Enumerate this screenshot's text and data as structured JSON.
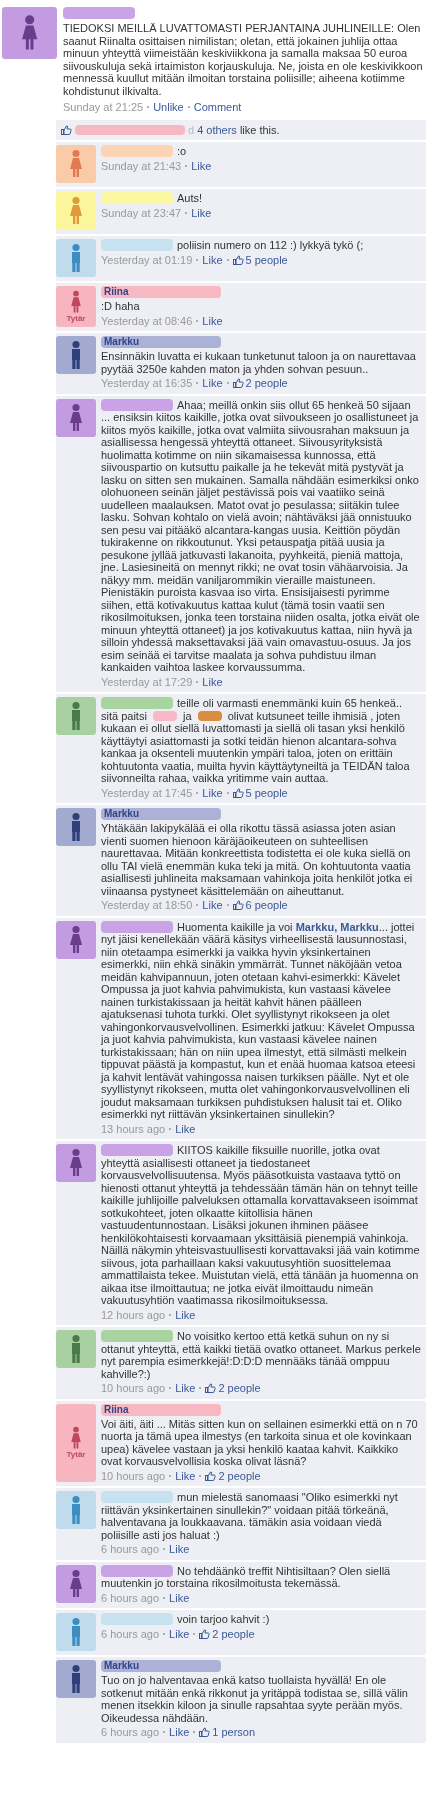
{
  "post": {
    "avatar": {
      "kind": "female",
      "color": "#c39be0",
      "figure": {
        "color": "#6a3d8c"
      }
    },
    "author": {
      "color": "#c9a3e6"
    },
    "text": "TIEDOKSI MEILLÄ LUVATTOMASTI PERJANTAINA JUHLINEILLE: Olen saanut Riinalta osittaisen nimilistan; oletan, että jokainen juhlija ottaa minuun yhteyttä viimeistään keskiviikkona ja samalla maksaa 50 euroa siivouskuluja sekä irtaimiston korjauskuluja. Ne, joista en ole keskivikkoon mennessä kuullut mitään ilmoitan torstaina poliisille; aiheena kotiimme kohdistunut ilkivalta.",
    "time": "Sunday at 21:25",
    "actions": [
      "Unlike",
      "Comment"
    ]
  },
  "likes": {
    "redaction": {
      "color": "#f7b8c4"
    },
    "prefix": "d",
    "link": "4 others",
    "suffix": "like this."
  },
  "comments": [
    {
      "avatar": {
        "kind": "female",
        "color": "#f9cba8",
        "figure": {
          "color": "#e07b50"
        }
      },
      "author": {
        "color": "#fcd3b4"
      },
      "text": ":o",
      "time": "Sunday at 21:43",
      "actions": [
        "Like"
      ]
    },
    {
      "avatar": {
        "kind": "female",
        "color": "#fbf59c",
        "figure": {
          "color": "#e09a3a"
        }
      },
      "author": {
        "color": "#fbf8a2"
      },
      "text": "Auts!",
      "time": "Sunday at 23:47",
      "actions": [
        "Like"
      ]
    },
    {
      "avatar": {
        "kind": "male",
        "color": "#c0dcec",
        "figure": {
          "color": "#3d8dc0"
        }
      },
      "author": {
        "color": "#c8e1ef"
      },
      "text": "poliisin numero on 112 :) lykkyä tykö (;",
      "time": "Yesterday at 01:19",
      "actions": [
        "Like"
      ],
      "people": "5 people"
    },
    {
      "avatar": {
        "kind": "female",
        "color": "#f7b5c0",
        "figure": {
          "color": "#c2475d"
        },
        "tag": "Tytär"
      },
      "author": {
        "color": "#f7b8c2",
        "name": "Riina"
      },
      "text": ":D haha",
      "time": "Yesterday at 08:46",
      "actions": [
        "Like"
      ]
    },
    {
      "avatar": {
        "kind": "male",
        "color": "#a3aacf",
        "figure": {
          "color": "#2e3f7a"
        }
      },
      "author": {
        "color": "#abb2d6",
        "name": "Markku"
      },
      "text": "Ensinnäkin luvatta ei kukaan tunketunut taloon ja on naurettavaa pyytää 3250e kahden maton ja yhden sohvan pesuun..",
      "time": "Yesterday at 16:35",
      "actions": [
        "Like"
      ],
      "people": "2 people"
    },
    {
      "avatar": {
        "kind": "female",
        "color": "#c39be0",
        "figure": {
          "color": "#6a3d8c"
        }
      },
      "author": {
        "color": "#c9a3e6"
      },
      "text": "Ahaa; meillä onkin siis ollut 65 henkeä 50 sijaan ... ensiksin kiitos kaikille, jotka ovat siivoukseen jo osallistuneet ja kiitos myös kaikille, jotka ovat valmiita siivousrahan maksuun ja asiallisessa hengessä yhteyttä ottaneet. Siivousyrityksistä huolimatta kotimme on niin sikamaisessa kunnossa, että siivouspartio on kutsuttu paikalle ja he tekevät mitä pystyvät ja lasku on sitten sen mukainen. Samalla nähdään esimerkiksi onko olohuoneen seinän jäljet pestävissä pois vai vaatiiko seinä uudelleen maalauksen. Matot ovat jo pesulassa; siitäkin tulee lasku. Sohvan kohtalo on vielä avoin; nähtäväksi jää onnistuuko sen pesu vai pitääkö alcantara-kangas uusia. Keittiön pöydän tukirakenne on rikkoutunut. Yksi petauspatja pitää uusia ja pesukone jyllää jatkuvasti lakanoita, pyyhkeitä, pieniä mattoja, jne. Lasiesineitä on mennyt rikki; ne ovat tosin vähäarvoisia. Ja näkyy mm. meidän vaniljarommikin vieraille maistuneen. Pienistäkin puroista kasvaa iso virta. Ensisijaisesti pyrimme siihen, että kotivakuutus kattaa kulut (tämä tosin vaatii sen rikosilmoituksen, jonka teen torstaina niiden osalta, jotka eivät ole minuun yhteyttä ottaneet) ja jos kotivakuutus kattaa, niin hyvä ja silloin yhdessä maksettavaksi jää vain omavastuu-osuus. Ja jos esim seinää ei tarvitse maalata ja sohva puhdistuu ilman kankaiden vaihtoa laskee korvaussumma.",
      "time": "Yesterday at 17:29",
      "actions": [
        "Like"
      ]
    },
    {
      "avatar": {
        "kind": "male",
        "color": "#a8d0a0",
        "figure": {
          "color": "#4a7a48"
        }
      },
      "author": {
        "color": "#a8d4a0"
      },
      "parts": [
        {
          "kind": "text",
          "text": "teille oli varmasti enemmänki kuin 65 henkeä.. sitä paitsi"
        },
        {
          "kind": "redaction",
          "color": "#f9b8c6"
        },
        {
          "kind": "text",
          "text": "ja"
        },
        {
          "kind": "redaction",
          "color": "#d98d3e"
        },
        {
          "kind": "text",
          "text": "olivat kutsuneet teille ihmisiä , joten kukaan ei ollut siellä luvattomasti ja siellä oli tasan yksi henkilö käyttäytyi asiattomasti ja sotki teidän hienon alcantara-sohva kankaa ja oksenteli muutenkin ympäri taloa, joten on erittäin kohtuutonta vaatia, muilta hyvin käyttäytyneiltä ja TEIDÄN taloa siivonneilta rahaa, vaikka yritimme vain auttaa."
        }
      ],
      "time": "Yesterday at 17:45",
      "actions": [
        "Like"
      ],
      "people": "5 people"
    },
    {
      "avatar": {
        "kind": "male",
        "color": "#a3aacf",
        "figure": {
          "color": "#2e3f7a"
        }
      },
      "author": {
        "color": "#abb2d6",
        "name": "Markku"
      },
      "text": "Yhtäkään lakipykälää ei olla rikottu tässä asiassa joten asian vienti suomen hienoon käräjäoikeuteen on suhteellisen naurettavaa. Mitään konkreettista todistetta ei ole kuka siellä on ollu TAI vielä enemmän kuka teki ja mitä. On kohtuutonta vaatia asiallisesti juhlineita maksamaan vahinkoja joita henkilöt jotka ei viinaansa pystyneet käsittelemään on aiheuttanut.",
      "time": "Yesterday at 18:50",
      "actions": [
        "Like"
      ],
      "people": "6 people"
    },
    {
      "avatar": {
        "kind": "female",
        "color": "#c39be0",
        "figure": {
          "color": "#6a3d8c"
        }
      },
      "author": {
        "color": "#c9a3e6"
      },
      "text": "Huomenta kaikille ja voi **Markku, Markku**... jottei nyt jäisi kenellekään väärä käsitys virheellisestä lausunnostasi, niin otetaampa esimerkki ja vaikka hyvin yksinkertainen esimerkki, niin ehkä sinäkin ymmärrät. Tunnet näköjään vetoa meidän kahvipannuun, joten otetaan kahvi-esimerkki: Kävelet Ompussa ja juot kahvia pahvimukista, kun vastaasi kävelee nainen turkistakissaan ja heität kahvit hänen päälleen ajatuksenasi tuhota turkki. Olet syyllistynyt rikokseen ja olet vahingonkorvausvelvollinen. Esimerkki jatkuu: Kävelet Ompussa ja juot kahvia pahvimukista, kun vastaasi kävelee nainen turkistakissaan; hän on niin upea ilmestyt, että silmästi melkein tippuvat päästä ja kompastut, kun et enää huomaa katsoa eteesi ja kahvit lentävät vahingossa naisen turkiksen päälle. Nyt et ole syyllistynyt rikokseen, mutta olet vahingonkorvausvelvollinen eli joudut maksamaan turkiksen puhdistuksen halusit tai et. Oliko esimerkki nyt riittävän yksinkertainen sinullekin?",
      "time": "13 hours ago",
      "actions": [
        "Like"
      ]
    },
    {
      "avatar": {
        "kind": "female",
        "color": "#c39be0",
        "figure": {
          "color": "#6a3d8c"
        }
      },
      "author": {
        "color": "#c9a3e6"
      },
      "text": "KIITOS kaikille fiksuille nuorille, jotka ovat yhteyttä asiallisesti ottaneet ja tiedostaneet korvausvelvollisuutensa. Myös pääsotkuista vastaava tyttö on hienosti ottanut yhteyttä ja tehdessään tämän hän on tehnyt teille kaikille juhlijoille palveluksen ottamalla korvattavakseen isoimmat sotkukohteet, joten olkaatte kiitollisia hänen vastuudentunnostaan. Lisäksi jokunen ihminen pääsee henkilökohtaisesti korvaamaan yksittäisiä pienempiä vahinkoja. Näillä näkymin yhteisvastuullisesti korvattavaksi jää vain kotimme siivous, jota parhaillaan kaksi vakuutusyhtiön suosittelemaa ammattilaista tekee. Muistutan vielä, että tänään ja huomenna on aikaa itse ilmoittautua; ne jotka eivät ilmoittaudu nimeän vakuutusyhtiön vaatimassa rikosilmoituksessa.",
      "time": "12 hours ago",
      "actions": [
        "Like"
      ]
    },
    {
      "avatar": {
        "kind": "male",
        "color": "#a8d0a0",
        "figure": {
          "color": "#4a7a48"
        }
      },
      "author": {
        "color": "#a8d4a0"
      },
      "text": "No voisitko kertoo että ketkä suhun on ny si ottanut yhteyttä, että kaikki tietää ovatko ottaneet. Markus perkele nyt parempia esimerkkejä!:D:D:D mennääks tänää omppuu kahville?:)",
      "time": "10 hours ago",
      "actions": [
        "Like"
      ],
      "people": "2 people"
    },
    {
      "avatar": {
        "kind": "female",
        "color": "#f7b5c0",
        "figure": {
          "color": "#c2475d"
        },
        "tag": "Tytär"
      },
      "author": {
        "color": "#f7b8c2",
        "name": "Riina"
      },
      "text": "Voi äiti, äiti ... Mitäs sitten kun on sellainen esimerkki että on n 70 nuorta ja tämä upea ilmestys (en tarkoita sinua et ole kovinkaan upea) kävelee vastaan ja yksi henkilö kaataa kahvit. Kaikkiko ovat korvausvelvollisia koska olivat läsnä?",
      "time": "10 hours ago",
      "actions": [
        "Like"
      ],
      "people": "2 people"
    },
    {
      "avatar": {
        "kind": "male",
        "color": "#c0dcec",
        "figure": {
          "color": "#3d8dc0"
        }
      },
      "author": {
        "color": "#c8e1ef"
      },
      "text": "mun mielestä sanomaasi \"Oliko esimerkki nyt riittävän yksinkertainen sinullekin?\" voidaan pitää törkeänä, halventavana ja loukkaavana. tämäkin asia voidaan viedä poliisille asti jos haluat :)",
      "time": "6 hours ago",
      "actions": [
        "Like"
      ]
    },
    {
      "avatar": {
        "kind": "female",
        "color": "#c39be0",
        "figure": {
          "color": "#6a3d8c"
        }
      },
      "author": {
        "color": "#c9a3e6"
      },
      "text": "No tehdäänkö treffit Nihtisiltaan? Olen siellä muutenkin jo torstaina rikosilmoitusta tekemässä.",
      "time": "6 hours ago",
      "actions": [
        "Like"
      ]
    },
    {
      "avatar": {
        "kind": "male",
        "color": "#c0dcec",
        "figure": {
          "color": "#3d8dc0"
        }
      },
      "author": {
        "color": "#c8e1ef"
      },
      "text": "voin tarjoo kahvit :)",
      "time": "6 hours ago",
      "actions": [
        "Like"
      ],
      "people": "2 people"
    },
    {
      "avatar": {
        "kind": "male",
        "color": "#a3aacf",
        "figure": {
          "color": "#2e3f7a"
        }
      },
      "author": {
        "color": "#abb2d6",
        "name": "Markku"
      },
      "text": "Tuo on jo halventavaa enkä katso tuollaista hyvällä! En ole sotkenut mitään enkä rikkonut ja yritäppä todistaa se, sillä välin menen itsekkin kiloon ja sinulle rapsahtaa syyte perään myös. Oikeudessa nähdään.",
      "time": "6 hours ago",
      "actions": [
        "Like"
      ],
      "people": "1 person"
    }
  ]
}
